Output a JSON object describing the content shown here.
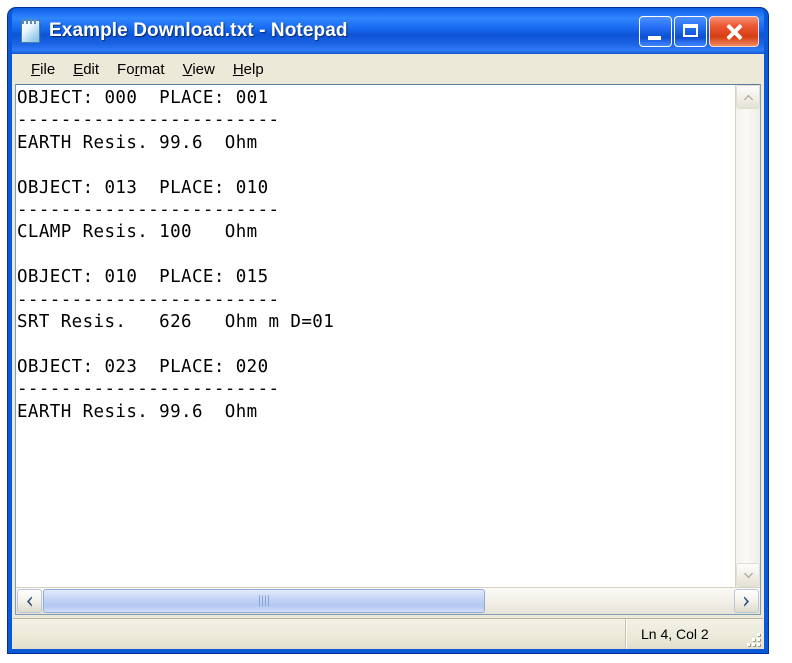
{
  "window": {
    "title": "Example Download.txt - Notepad",
    "icon": "notepad-icon",
    "caption_buttons": [
      {
        "name": "minimize",
        "label": "_"
      },
      {
        "name": "maximize",
        "label": "□"
      },
      {
        "name": "close",
        "label": "✕"
      }
    ]
  },
  "menubar": {
    "items": [
      {
        "name": "file",
        "mnemonic": "F",
        "rest": "ile"
      },
      {
        "name": "edit",
        "mnemonic": "E",
        "rest": "dit"
      },
      {
        "name": "format",
        "pre": "Fo",
        "mnemonic": "r",
        "rest": "mat"
      },
      {
        "name": "view",
        "mnemonic": "V",
        "rest": "iew"
      },
      {
        "name": "help",
        "mnemonic": "H",
        "rest": "elp"
      }
    ]
  },
  "document": {
    "lines": [
      "OBJECT: 000  PLACE: 001",
      "------------------------",
      "EARTH Resis. 99.6  Ohm",
      "",
      "OBJECT: 013  PLACE: 010",
      "------------------------",
      "CLAMP Resis. 100   Ohm",
      "",
      "OBJECT: 010  PLACE: 015",
      "------------------------",
      "SRT Resis.   626   Ohm m D=01",
      "",
      "OBJECT: 023  PLACE: 020",
      "------------------------",
      "EARTH Resis. 99.6  Ohm"
    ]
  },
  "scrollbars": {
    "vertical": {
      "up_icon": "chevron-up-icon",
      "down_icon": "chevron-down-icon",
      "enabled": false
    },
    "horizontal": {
      "left_icon": "chevron-left-icon",
      "right_icon": "chevron-right-icon",
      "enabled": true
    }
  },
  "statusbar": {
    "position": "Ln 4, Col 2",
    "grip": "resize-grip"
  },
  "colors": {
    "titlebar_blue": "#1464ec",
    "frame_blue": "#0a59d8",
    "close_red": "#d53d12",
    "client_beige": "#ece9d8",
    "text_black": "#000000",
    "scrollbar_thumb": "#b2c7f2"
  }
}
